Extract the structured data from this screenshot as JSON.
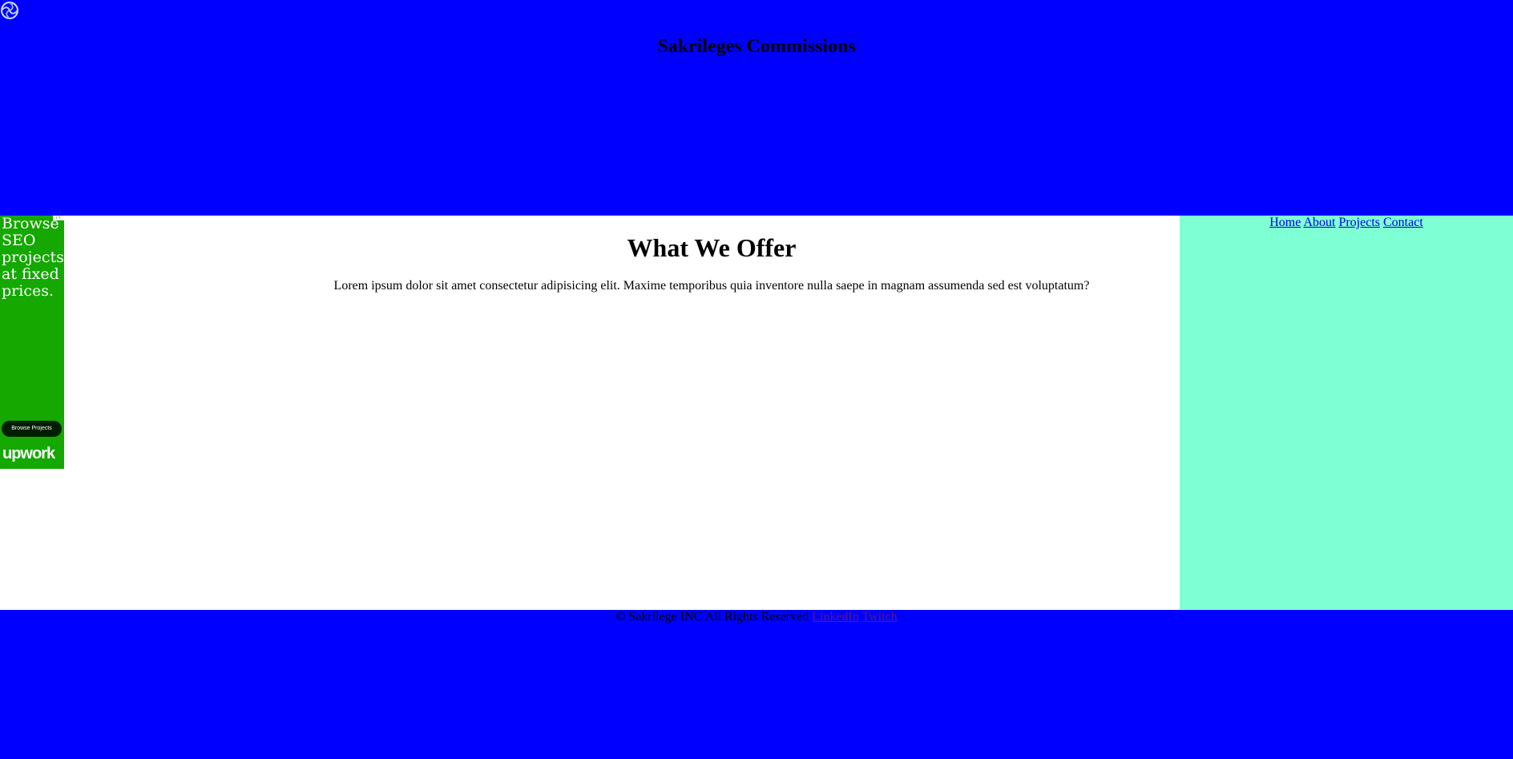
{
  "header": {
    "title": "Sakrileges Commissions",
    "logo_icon": "spiral-logo-icon"
  },
  "main": {
    "heading": "What We Offer",
    "paragraph": "Lorem ipsum dolor sit amet consectetur adipisicing elit. Maxime temporibus quia inventore nulla saepe in magnam assumenda sed est voluptatum?"
  },
  "nav": {
    "items": [
      {
        "label": "Home"
      },
      {
        "label": "About"
      },
      {
        "label": "Projects"
      },
      {
        "label": "Contact"
      }
    ]
  },
  "ad": {
    "headline": "Browse SEO projects at fixed prices.",
    "button_label": "Browse Projects",
    "brand": "upwork",
    "choices_label": "i ×",
    "background_color": "#14a800"
  },
  "footer": {
    "copyright": "© Sakrilege INC All Rights Reserved",
    "links": [
      {
        "label": "LinkedIn"
      },
      {
        "label": "Twitch"
      }
    ]
  },
  "colors": {
    "header_bg": "#0000ff",
    "sidebar_bg": "#7fffd4",
    "main_bg": "#ffffff",
    "footer_bg": "#0000ff"
  }
}
